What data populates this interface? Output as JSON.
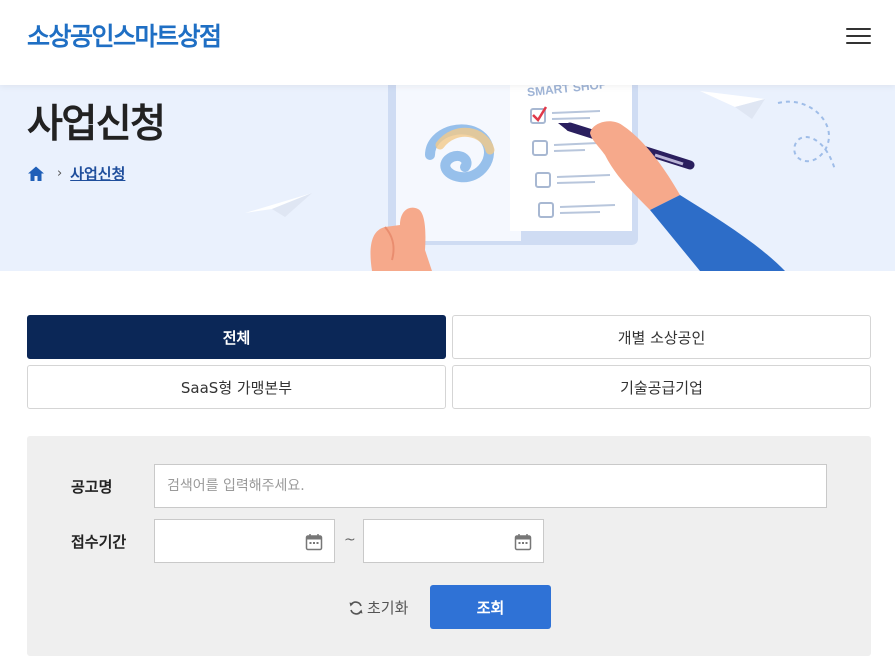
{
  "header": {
    "logo": "소상공인스마트상점",
    "menu_icon": "hamburger-menu-icon"
  },
  "hero": {
    "title": "사업신청",
    "illustration_text": "SMART SHOP",
    "breadcrumb": {
      "home_icon": "home-icon",
      "separator": "›",
      "current": "사업신청"
    }
  },
  "tabs": [
    {
      "label": "전체",
      "active": true
    },
    {
      "label": "개별 소상공인",
      "active": false
    },
    {
      "label": "SaaS형 가맹본부",
      "active": false
    },
    {
      "label": "기술공급기업",
      "active": false
    }
  ],
  "search": {
    "title_label": "공고명",
    "title_placeholder": "검색어를 입력해주세요.",
    "title_value": "",
    "period_label": "접수기간",
    "start_date": "",
    "end_date": "",
    "period_separator": "~",
    "calendar_icon": "calendar-icon",
    "reset_icon": "refresh-icon",
    "reset_label": "초기화",
    "submit_label": "조회"
  },
  "colors": {
    "brand": "#1f6fc4",
    "active_tab": "#0b2757",
    "submit": "#2f72d6",
    "hero_bg": "#eaf1fd"
  }
}
